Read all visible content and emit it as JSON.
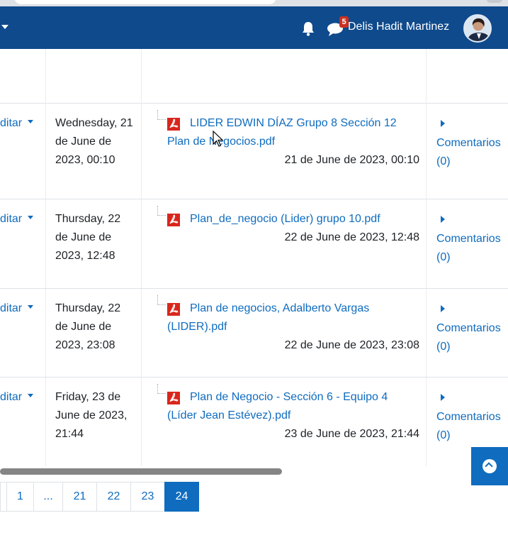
{
  "navbar": {
    "username": "Delis Hadit Martinez",
    "message_count": "5"
  },
  "submissions": [
    {
      "edit_label": "ditar",
      "date": "Wednesday, 21 de June de 2023, 00:10",
      "file_name": "LIDER EDWIN DÍAZ Grupo 8 Sección 12 Plan de Negocios.pdf",
      "file_time": "21 de June de 2023, 00:10",
      "comments": "Comentarios (0)"
    },
    {
      "edit_label": "ditar",
      "date": "Thursday, 22 de June de 2023, 12:48",
      "file_name": "Plan_de_negocio (Lider) grupo 10.pdf",
      "file_time": "22 de June de 2023, 12:48",
      "comments": "Comentarios (0)"
    },
    {
      "edit_label": "ditar",
      "date": "Thursday, 22 de June de 2023, 23:08",
      "file_name": "Plan de negocios, Adalberto Vargas (LIDER).pdf",
      "file_time": "22 de June de 2023, 23:08",
      "comments": "Comentarios (0)"
    },
    {
      "edit_label": "ditar",
      "date": "Friday, 23 de June de 2023, 21:44",
      "file_name": "Plan de Negocio - Sección 6 - Equipo 4 (Líder Jean Estévez).pdf",
      "file_time": "23 de June de 2023, 21:44",
      "comments": "Comentarios (0)"
    }
  ],
  "pagination": {
    "pages": [
      "1",
      "...",
      "21",
      "22",
      "23",
      "24"
    ],
    "current": "24"
  },
  "colors": {
    "navbar": "#0f4a8c",
    "link": "#0f6cbf",
    "badge": "#ca3120",
    "pdf_icon": "#d9261c"
  },
  "icons": [
    "bell-icon",
    "chat-icon",
    "pdf-icon",
    "caret-down-icon",
    "caret-right-icon",
    "back-to-top-icon"
  ]
}
